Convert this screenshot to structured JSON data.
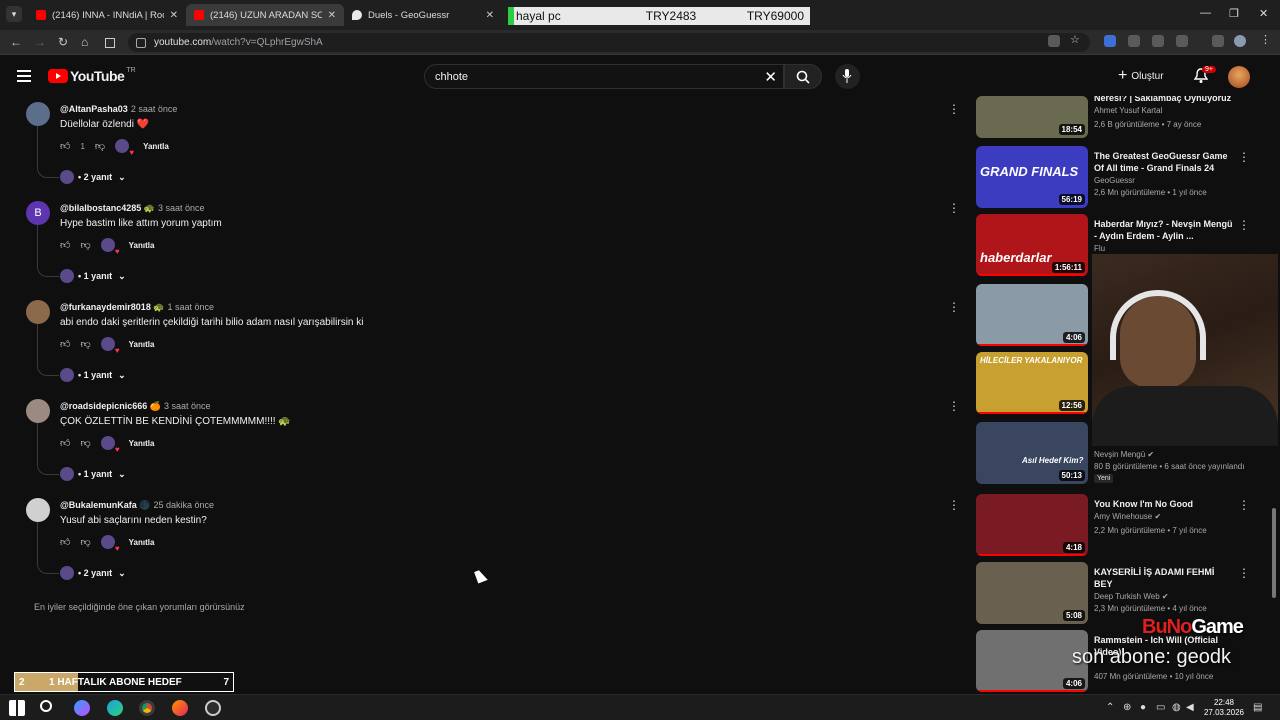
{
  "browser": {
    "tabs": [
      {
        "title": "(2146) INNA - INNdiA | Rock th",
        "active": false,
        "close": "✕"
      },
      {
        "title": "(2146) UZUN ARADAN SONRA",
        "active": true,
        "close": "✕"
      },
      {
        "title": "Duels - GeoGuessr",
        "active": false,
        "close": "✕"
      }
    ],
    "stock_ticker": {
      "name": "hayal pc",
      "value1": "TRY2483",
      "value2": "TRY69000"
    },
    "url_host": "youtube.com",
    "url_path": "/watch?v=QLphrEgwShA",
    "window_controls": {
      "minimize": "—",
      "maximize": "❐",
      "close": "✕"
    },
    "nav": {
      "back": "←",
      "forward": "→",
      "reload": "↻",
      "home": "⌂"
    }
  },
  "youtube": {
    "logo_text": "YouTube",
    "country_code": "TR",
    "search_value": "chhote",
    "clear": "✕",
    "create_label": "Oluştur",
    "create_plus": "+",
    "notifications": "9+"
  },
  "comments": [
    {
      "author": "@AltanPasha03",
      "time": "2 saat önce",
      "text": "Düellolar özlendi ❤️",
      "likes": "1",
      "reply_label": "Yanıtla",
      "replies": "• 2 yanıt",
      "avatar_color": "#5b6e8a",
      "avatar_letter": ""
    },
    {
      "author": "@bilalbostanc4285 🐢",
      "time": "3 saat önce",
      "text": "Hype bastim like attım yorum yaptım",
      "likes": "",
      "reply_label": "Yanıtla",
      "replies": "• 1 yanıt",
      "avatar_color": "#5e35b1",
      "avatar_letter": "B"
    },
    {
      "author": "@furkanaydemir8018 🐢",
      "time": "1 saat önce",
      "text": "abi endo daki şeritlerin  çekildiği tarihi bilio adam nasıl yarışabilirsin ki",
      "likes": "",
      "reply_label": "Yanıtla",
      "replies": "• 1 yanıt",
      "avatar_color": "#8a6a4a",
      "avatar_letter": ""
    },
    {
      "author": "@roadsidepicnic666 🍊",
      "time": "3 saat önce",
      "text": "ÇOK ÖZLETTİN BE KENDİNİ ÇOTEMMMMM!!!! 🐢",
      "likes": "",
      "reply_label": "Yanıtla",
      "replies": "• 1 yanıt",
      "avatar_color": "#9a8a80",
      "avatar_letter": ""
    },
    {
      "author": "@BukalemunKafa 🌑",
      "time": "25 dakika önce",
      "text": "Yusuf abi saçlarını neden kestin?",
      "likes": "",
      "reply_label": "Yanıtla",
      "replies": "• 2 yanıt",
      "avatar_color": "#d0d0d0",
      "avatar_letter": ""
    }
  ],
  "comments_footer": "En iyiler seçildiğinde öne çıkan yorumları görürsünüz",
  "recommendations": [
    {
      "title": "Neresi? | Saklambaç Oynuyoruz",
      "channel": "Ahmet Yusuf Kartal",
      "meta": "2,6 B görüntüleme • 7 ay önce",
      "duration": "18:54",
      "thumb_color": "#6a6a50",
      "thumb_text": "",
      "new": ""
    },
    {
      "title": "The Greatest GeoGuessr Game Of All time - Grand Finals 24",
      "channel": "GeoGuessr",
      "meta": "2,6 Mn görüntüleme • 1 yıl önce",
      "duration": "56:19",
      "thumb_color": "#3b3cc0",
      "thumb_text": "GRAND FINALS",
      "new": ""
    },
    {
      "title": "Haberdar Mıyız? - Nevşin Mengü - Aydın Erdem - Aylin ...",
      "channel": "Flu",
      "meta": "",
      "duration": "1:56:11",
      "thumb_color": "#b0151a",
      "thumb_text": "haberdarlar",
      "new": ""
    },
    {
      "title": "",
      "channel": "",
      "meta": "",
      "duration": "4:06",
      "thumb_color": "#8a9aa6",
      "thumb_text": "",
      "new": ""
    },
    {
      "title": "",
      "channel": "",
      "meta": "",
      "duration": "12:56",
      "thumb_color": "#c8a030",
      "thumb_text": "HİLECİLER YAKALANIYOR",
      "new": ""
    },
    {
      "title": "",
      "channel": "Nevşin Mengü ✔",
      "meta": "80 B görüntüleme • 6 saat önce yayınlandı",
      "duration": "50:13",
      "thumb_color": "#3a4660",
      "thumb_text": "Asıl Hedef Kim?",
      "new": "Yeni"
    },
    {
      "title": "You Know I'm No Good",
      "channel": "Amy Winehouse ✔",
      "meta": "2,2 Mn görüntüleme • 7 yıl önce",
      "duration": "4:18",
      "thumb_color": "#7a1a22",
      "thumb_text": "",
      "new": ""
    },
    {
      "title": "KAYSERİLİ İŞ ADAMI FEHMİ BEY",
      "channel": "Deep Turkish Web ✔",
      "meta": "2,3 Mn görüntüleme • 4 yıl önce",
      "duration": "5:08",
      "thumb_color": "#6a6050",
      "thumb_text": "",
      "new": ""
    },
    {
      "title": "Rammstein - Ich Will (Official Video)",
      "channel": "",
      "meta": "407 Mn görüntüleme • 10 yıl önce",
      "duration": "4:06",
      "thumb_color": "#707070",
      "thumb_text": "",
      "new": ""
    }
  ],
  "overlay": {
    "brand_a": "BuNo",
    "brand_b": "Game",
    "last_subscriber": "son abone: geodk",
    "goal_current": "2",
    "goal_label": "1 HAFTALIK ABONE HEDEF",
    "goal_target": "7",
    "goal_progress": 0.29
  },
  "taskbar": {
    "time": "22:48",
    "date": "27.03.2026",
    "apps": [
      "start",
      "search",
      "copilot",
      "edge",
      "chrome",
      "firefox",
      "obs"
    ]
  }
}
